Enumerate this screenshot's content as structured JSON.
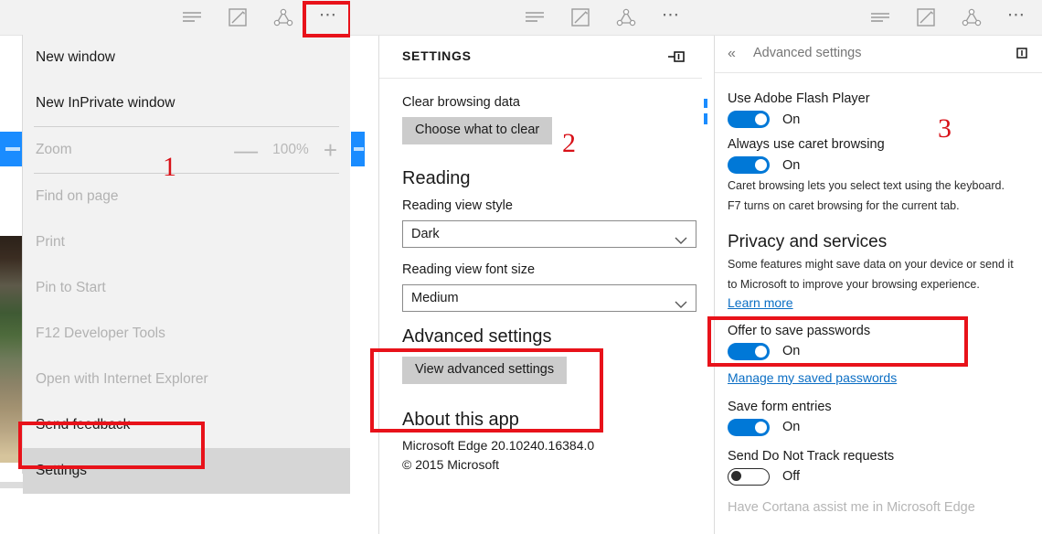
{
  "toolbar": {
    "icons": [
      {
        "name": "reading-list-icon",
        "glyph": "hub"
      },
      {
        "name": "web-note-icon",
        "glyph": "note"
      },
      {
        "name": "share-icon",
        "glyph": "share"
      },
      {
        "name": "more-actions-icon",
        "glyph": "..."
      }
    ]
  },
  "annotations": [
    {
      "label": "1"
    },
    {
      "label": "2"
    },
    {
      "label": "3"
    }
  ],
  "panel1": {
    "menu_items": [
      {
        "label": "New window",
        "state": "enabled"
      },
      {
        "label": "New InPrivate window",
        "state": "enabled"
      }
    ],
    "zoom": {
      "label": "Zoom",
      "minus": "—",
      "value": "100%",
      "plus": "+"
    },
    "disabled_items": [
      {
        "label": "Find on page"
      },
      {
        "label": "Print"
      },
      {
        "label": "Pin to Start"
      },
      {
        "label": "F12 Developer Tools"
      },
      {
        "label": "Open with Internet Explorer"
      }
    ],
    "send_feedback": "Send feedback",
    "settings": "Settings"
  },
  "panel2": {
    "header_title": "SETTINGS",
    "clear_browsing": {
      "label": "Clear browsing data",
      "button": "Choose what to clear"
    },
    "reading": {
      "heading": "Reading",
      "style_label": "Reading view style",
      "style_value": "Dark",
      "font_label": "Reading view font size",
      "font_value": "Medium"
    },
    "advanced": {
      "heading": "Advanced settings",
      "button": "View advanced settings"
    },
    "about": {
      "heading": "About this app",
      "version": "Microsoft Edge 20.10240.16384.0",
      "copyright": "© 2015 Microsoft"
    }
  },
  "panel3": {
    "header_title": "Advanced settings",
    "back_glyph": "«",
    "settings": [
      {
        "label": "Use Adobe Flash Player",
        "state": "On",
        "on": true
      },
      {
        "label": "Always use caret browsing",
        "state": "On",
        "on": true
      }
    ],
    "caret_desc_line1": "Caret browsing lets you select text using the keyboard.",
    "caret_desc_line2": "F7 turns on caret browsing for the current tab.",
    "privacy": {
      "heading": "Privacy and services",
      "desc_line1": "Some features might save data on your device or send it",
      "desc_line2": "to Microsoft to improve your browsing experience.",
      "learn_more": "Learn more"
    },
    "passwords": {
      "label": "Offer to save passwords",
      "state": "On",
      "manage_link": "Manage my saved passwords"
    },
    "form_entries": {
      "label": "Save form entries",
      "state": "On"
    },
    "do_not_track": {
      "label": "Send Do Not Track requests",
      "state": "Off"
    },
    "cortana": {
      "label": "Have Cortana assist me in Microsoft Edge"
    }
  }
}
